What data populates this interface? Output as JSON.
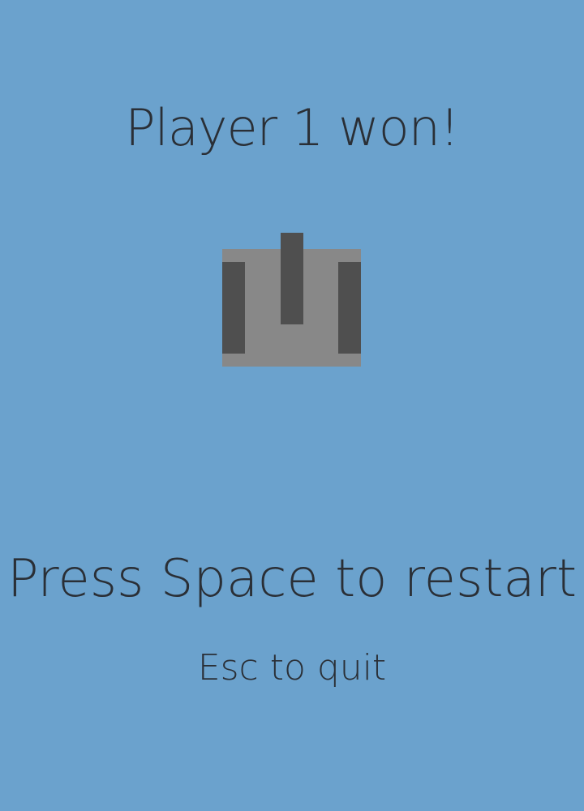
{
  "game": {
    "result_text": "Player 1 won!",
    "restart_hint": "Press Space to restart",
    "quit_hint": "Esc to quit"
  },
  "colors": {
    "background": "#6ba2cd",
    "text": "#2a2f36",
    "tank_body": "#888888",
    "tank_dark": "#4f4f4f"
  },
  "icons": {
    "winner_sprite": "tank-icon"
  }
}
